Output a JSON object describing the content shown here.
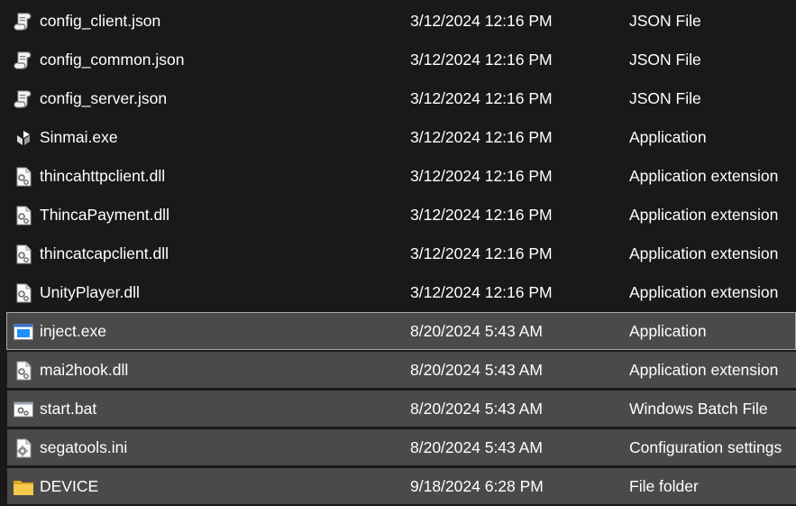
{
  "files": [
    {
      "name": "config_client.json",
      "date": "3/12/2024 12:16 PM",
      "type": "JSON File",
      "icon": "json-script-icon",
      "selected": false
    },
    {
      "name": "config_common.json",
      "date": "3/12/2024 12:16 PM",
      "type": "JSON File",
      "icon": "json-script-icon",
      "selected": false
    },
    {
      "name": "config_server.json",
      "date": "3/12/2024 12:16 PM",
      "type": "JSON File",
      "icon": "json-script-icon",
      "selected": false
    },
    {
      "name": "Sinmai.exe",
      "date": "3/12/2024 12:16 PM",
      "type": "Application",
      "icon": "unity-app-icon",
      "selected": false
    },
    {
      "name": "thincahttpclient.dll",
      "date": "3/12/2024 12:16 PM",
      "type": "Application extension",
      "icon": "dll-gear-icon",
      "selected": false
    },
    {
      "name": "ThincaPayment.dll",
      "date": "3/12/2024 12:16 PM",
      "type": "Application extension",
      "icon": "dll-gear-icon",
      "selected": false
    },
    {
      "name": "thincatcapclient.dll",
      "date": "3/12/2024 12:16 PM",
      "type": "Application extension",
      "icon": "dll-gear-icon",
      "selected": false
    },
    {
      "name": "UnityPlayer.dll",
      "date": "3/12/2024 12:16 PM",
      "type": "Application extension",
      "icon": "dll-gear-icon",
      "selected": false
    },
    {
      "name": "inject.exe",
      "date": "8/20/2024 5:43 AM",
      "type": "Application",
      "icon": "exe-window-icon",
      "selected": true,
      "focused": true
    },
    {
      "name": "mai2hook.dll",
      "date": "8/20/2024 5:43 AM",
      "type": "Application extension",
      "icon": "dll-gear-icon",
      "selected": true
    },
    {
      "name": "start.bat",
      "date": "8/20/2024 5:43 AM",
      "type": "Windows Batch File",
      "icon": "batch-gear-icon",
      "selected": true
    },
    {
      "name": "segatools.ini",
      "date": "8/20/2024 5:43 AM",
      "type": "Configuration settings",
      "icon": "ini-settings-icon",
      "selected": true
    },
    {
      "name": "DEVICE",
      "date": "9/18/2024 6:28 PM",
      "type": "File folder",
      "icon": "folder-icon",
      "selected": true
    }
  ],
  "colors": {
    "background": "#191919",
    "selection": "#4a4a4a",
    "focus_border": "#a6a6a6",
    "text": "#ffffff",
    "folder": "#f0c14b"
  }
}
